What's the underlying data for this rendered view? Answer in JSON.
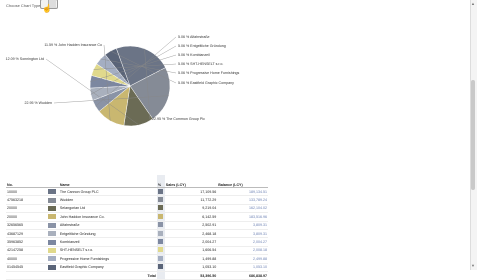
{
  "header": {
    "chart_type_label": "Choose Chart Type:"
  },
  "chart_data": {
    "type": "pie",
    "slices": [
      {
        "name": "The Common Group PLC",
        "percent": 22.95,
        "label": "22.95 % The Common Group Plc",
        "color": "#6b7486"
      },
      {
        "name": "Wudden",
        "percent": 22.95,
        "label": "22.95 % Wudden",
        "color": "#858b96"
      },
      {
        "name": "Sonnington Ltd",
        "percent": 12.09,
        "label": "12.09 % Sonnington Ltd",
        "color": "#6b6b55"
      },
      {
        "name": "John Hadden Insurance Co",
        "percent": 11.59,
        "label": "11.59 % John Hadden Insurance Co",
        "color": "#c9b770"
      },
      {
        "name": "Alfahrstraße",
        "percent": 5.06,
        "label": "5.06 % Alfahrstraße",
        "color": "#8a93a6"
      },
      {
        "name": "Entgeltliche Gründung",
        "percent": 5.06,
        "label": "5.06 % Entgeltliche Gründung",
        "color": "#a9b0bd"
      },
      {
        "name": "Kombianzeil",
        "percent": 5.06,
        "label": "5.06 % Kombianzeil",
        "color": "#7c87a0"
      },
      {
        "name": "SHT-HENSELT s.r.o.",
        "percent": 5.06,
        "label": "5.06 % SHT-HENSELT s.r.o.",
        "color": "#e0d98c"
      },
      {
        "name": "Progressive Home Furnishings",
        "percent": 5.06,
        "label": "5.06 % Progressive Home Furnishings",
        "color": "#a4aec2"
      },
      {
        "name": "Eastfield Graphic Company",
        "percent": 5.06,
        "label": "5.06 % Eastfield Graphic Company",
        "color": "#5a6478"
      }
    ]
  },
  "table": {
    "headers": {
      "no": "No.",
      "name": "Name",
      "pct": "%",
      "sales": "Sales (LCY)",
      "balance": "Balance (LCY)"
    },
    "rows": [
      {
        "no": "10000",
        "name": "The Cannon Group PLC",
        "sales": "17,109.56",
        "balance": "189,134.51",
        "color": "#6b7486"
      },
      {
        "no": "47563218",
        "name": "Wudden",
        "sales": "11,772.29",
        "balance": "133,789.24",
        "color": "#858b96"
      },
      {
        "no": "20000",
        "name": "Selangorian Ltd",
        "sales": "9,219.04",
        "balance": "162,104.02",
        "color": "#6b6b55"
      },
      {
        "no": "20000",
        "name": "John Haddon Insurance Co.",
        "sales": "6,142.59",
        "balance": "183,516.96",
        "color": "#c9b770"
      },
      {
        "no": "32656565",
        "name": "Alfahrstraße",
        "sales": "2,502.91",
        "balance": "3,809.31",
        "color": "#8a93a6"
      },
      {
        "no": "43687129",
        "name": "Entgeltliche Gründung",
        "sales": "2,468.18",
        "balance": "3,809.31",
        "color": "#a9b0bd"
      },
      {
        "no": "35963852",
        "name": "Kombianzeil",
        "sales": "2,004.27",
        "balance": "2,004.27",
        "color": "#7c87a0"
      },
      {
        "no": "42147258",
        "name": "SHT-HENSELT s.r.o.",
        "sales": "1,606.54",
        "balance": "2,008.18",
        "color": "#e0d98c"
      },
      {
        "no": "40000",
        "name": "Progressive Home Furnishings",
        "sales": "1,499.88",
        "balance": "2,499.88",
        "color": "#a4aec2"
      },
      {
        "no": "01454545",
        "name": "Eastfield Graphic Company",
        "sales": "1,053.10",
        "balance": "1,053.10",
        "color": "#5a6478"
      }
    ],
    "total": {
      "label": "Total",
      "sales": "53,396.50",
      "balance": "686,838.97"
    }
  },
  "scrollbar": {
    "up_arrow": "▲",
    "down_arrow": "▼"
  }
}
